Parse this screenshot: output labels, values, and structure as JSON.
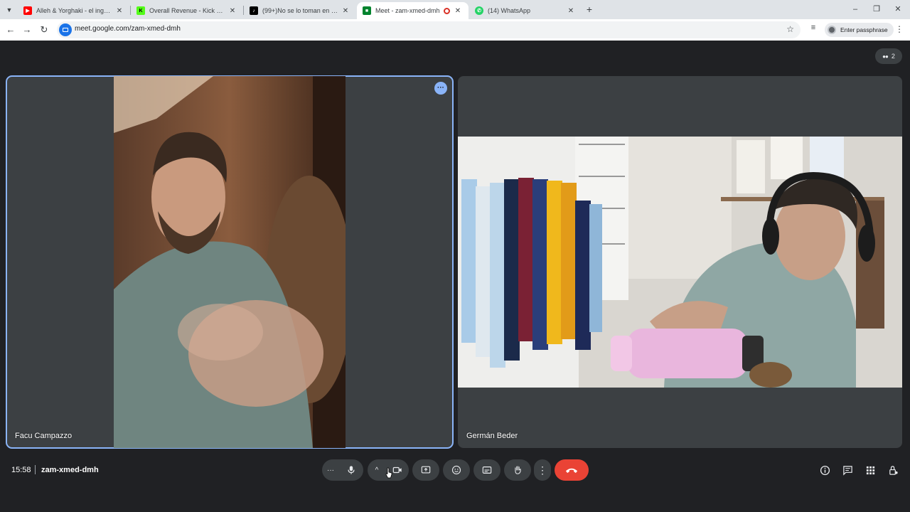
{
  "browser": {
    "tabs": [
      {
        "title": "Alleh & Yorghaki - el ingeniero",
        "favicon": "youtube-icon",
        "color": "#ff0000",
        "active": false
      },
      {
        "title": "Overall Revenue - Kick Dashboa",
        "favicon": "kick-icon",
        "color": "#53fc18",
        "active": false
      },
      {
        "title": "(99+)No se lo toman en serio a",
        "favicon": "tiktok-icon",
        "color": "#000000",
        "active": false
      },
      {
        "title": "Meet - zam-xmed-dmh",
        "favicon": "meet-icon",
        "color": "#00832d",
        "active": true
      },
      {
        "title": "(14) WhatsApp",
        "favicon": "whatsapp-icon",
        "color": "#25d366",
        "active": false
      }
    ],
    "url": "meet.google.com/zam-xmed-dmh",
    "profile_label": "Enter passphrase"
  },
  "meet": {
    "participant_count": "2",
    "participants": [
      {
        "name": "Facu Campazzo",
        "speaking": true
      },
      {
        "name": "Germán Beder",
        "speaking": false
      }
    ],
    "time": "15:58",
    "meeting_code": "zam-xmed-dmh",
    "colors": {
      "background": "#202124",
      "tile": "#3c4043",
      "accent": "#8ab4f8",
      "leave": "#ea4335"
    }
  }
}
